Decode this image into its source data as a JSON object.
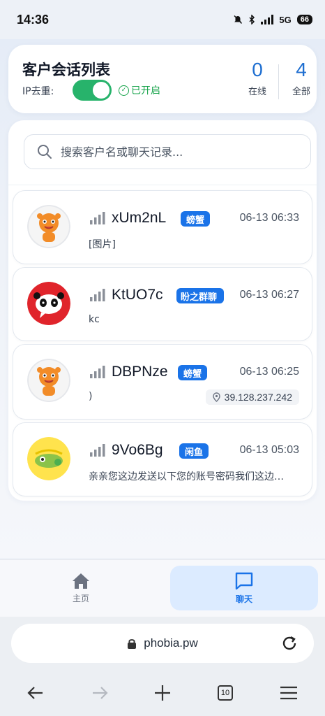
{
  "status_bar": {
    "time": "14:36",
    "network": "5G",
    "battery": "66",
    "icons": [
      "mute-icon",
      "bluetooth-icon",
      "signal-icon",
      "battery-icon"
    ]
  },
  "header": {
    "title": "客户会话列表",
    "ip_dedup_label": "IP去重:",
    "ip_dedup_enabled": true,
    "ip_dedup_status": "已开启",
    "online_count": "0",
    "online_label": "在线",
    "total_count": "4",
    "total_label": "全部"
  },
  "search": {
    "placeholder": "搜索客户名或聊天记录..."
  },
  "chats": [
    {
      "name": "xUm2nL",
      "platform": "螃蟹",
      "time": "06-13 06:33",
      "message": "[图片]",
      "avatar": "tiger-cartoon-avatar",
      "ip": ""
    },
    {
      "name": "KtUO7c",
      "platform": "盼之群聊",
      "time": "06-13 06:27",
      "message": "kc",
      "avatar": "panda-logo-avatar",
      "ip": ""
    },
    {
      "name": "DBPNze",
      "platform": "螃蟹",
      "time": "06-13 06:25",
      "message": ")",
      "avatar": "tiger-cartoon-avatar",
      "ip": "39.128.237.242"
    },
    {
      "name": "9Vo6Bg",
      "platform": "闲鱼",
      "time": "06-13 05:03",
      "message": "亲亲您这边发送以下您的账号密码我们这边…",
      "avatar": "xianyu-fish-avatar",
      "ip": ""
    }
  ],
  "bottom_nav": {
    "home_label": "主页",
    "chat_label": "聊天",
    "active": "chat"
  },
  "browser": {
    "url": "phobia.pw",
    "tab_count": "10"
  },
  "colors": {
    "accent": "#1a73e8",
    "toggle_on": "#27b36b",
    "success": "#16a34a"
  }
}
